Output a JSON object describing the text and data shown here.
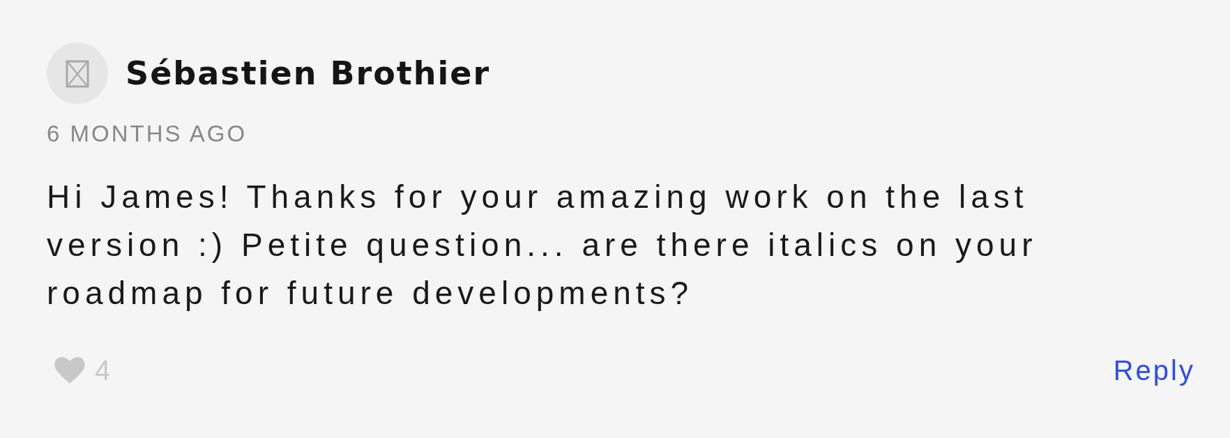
{
  "comment": {
    "author": "Sébastien Brothier",
    "timestamp": "6 MONTHS AGO",
    "body": "Hi James! Thanks for your amazing work on the last version :) Petite question... are there italics on your roadmap for future developments?",
    "likes": {
      "count": "4",
      "liked": false
    },
    "reply": "Reply"
  }
}
